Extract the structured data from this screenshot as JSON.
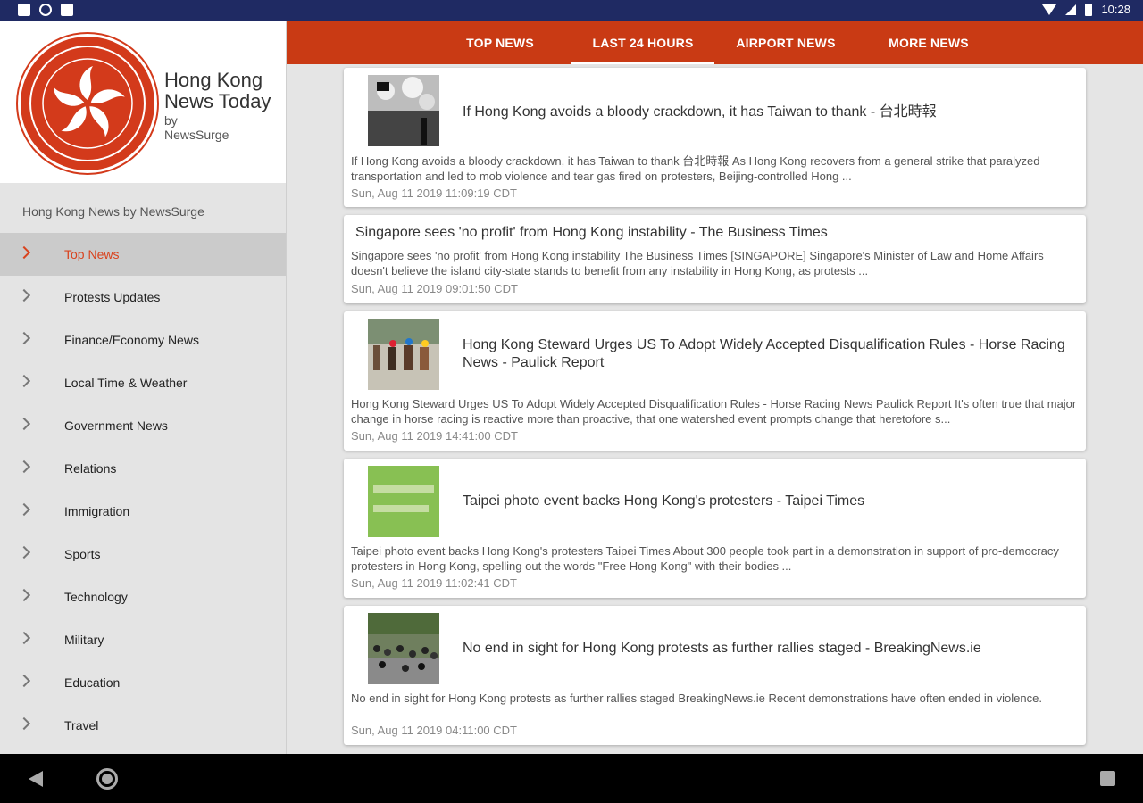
{
  "status": {
    "time": "10:28"
  },
  "drawer": {
    "app_title": "Hong Kong News Today",
    "app_by": "by",
    "app_author": "NewsSurge",
    "subtitle": "Hong Kong News by NewsSurge",
    "items": [
      {
        "label": "Top News"
      },
      {
        "label": "Protests Updates"
      },
      {
        "label": "Finance/Economy News"
      },
      {
        "label": "Local Time & Weather"
      },
      {
        "label": "Government News"
      },
      {
        "label": "Relations"
      },
      {
        "label": "Immigration"
      },
      {
        "label": "Sports"
      },
      {
        "label": "Technology"
      },
      {
        "label": "Military"
      },
      {
        "label": "Education"
      },
      {
        "label": "Travel"
      }
    ]
  },
  "tabs": [
    {
      "label": "TOP NEWS"
    },
    {
      "label": "LAST 24 HOURS"
    },
    {
      "label": "AIRPORT NEWS"
    },
    {
      "label": "MORE NEWS"
    }
  ],
  "articles": [
    {
      "title": "If Hong Kong avoids a bloody crackdown, it has Taiwan to thank - 台北時報",
      "desc": "If Hong Kong avoids a bloody crackdown, it has Taiwan to thank  台北時報  As Hong Kong recovers from a general strike that paralyzed transportation and led to mob violence and tear gas fired on protesters, Beijing-controlled Hong ...",
      "date": "Sun, Aug 11 2019 11:09:19 CDT"
    },
    {
      "title": "Singapore sees 'no profit' from Hong Kong instability - The Business Times",
      "desc": "Singapore sees 'no profit' from Hong Kong instability  The Business Times  [SINGAPORE] Singapore's Minister of Law and Home Affairs doesn't believe the island city-state stands to benefit from any instability in Hong Kong, as protests ...",
      "date": "Sun, Aug 11 2019 09:01:50 CDT"
    },
    {
      "title": "Hong Kong Steward Urges US To Adopt Widely Accepted Disqualification Rules - Horse Racing News - Paulick Report",
      "desc": "Hong Kong Steward Urges US To Adopt Widely Accepted Disqualification Rules - Horse Racing News  Paulick Report  It's often true that major change in horse racing is reactive more than proactive, that one watershed event prompts change that heretofore s...",
      "date": "Sun, Aug 11 2019 14:41:00 CDT"
    },
    {
      "title": "Taipei photo event backs Hong Kong's protesters - Taipei Times",
      "desc": "Taipei photo event backs Hong Kong's protesters  Taipei Times  About 300 people took part in a demonstration in support of pro-democracy protesters in Hong Kong, spelling out the words \"Free Hong Kong\" with their bodies ...",
      "date": "Sun, Aug 11 2019 11:02:41 CDT"
    },
    {
      "title": "No end in sight for Hong Kong protests as further rallies staged - BreakingNews.ie",
      "desc": "No end in sight for Hong Kong protests as further rallies staged  BreakingNews.ie  Recent demonstrations have often ended in violence.",
      "date": "Sun, Aug 11 2019 04:11:00 CDT"
    }
  ],
  "colors": {
    "accent": "#c93a14",
    "status_bar": "#1f2a63"
  }
}
